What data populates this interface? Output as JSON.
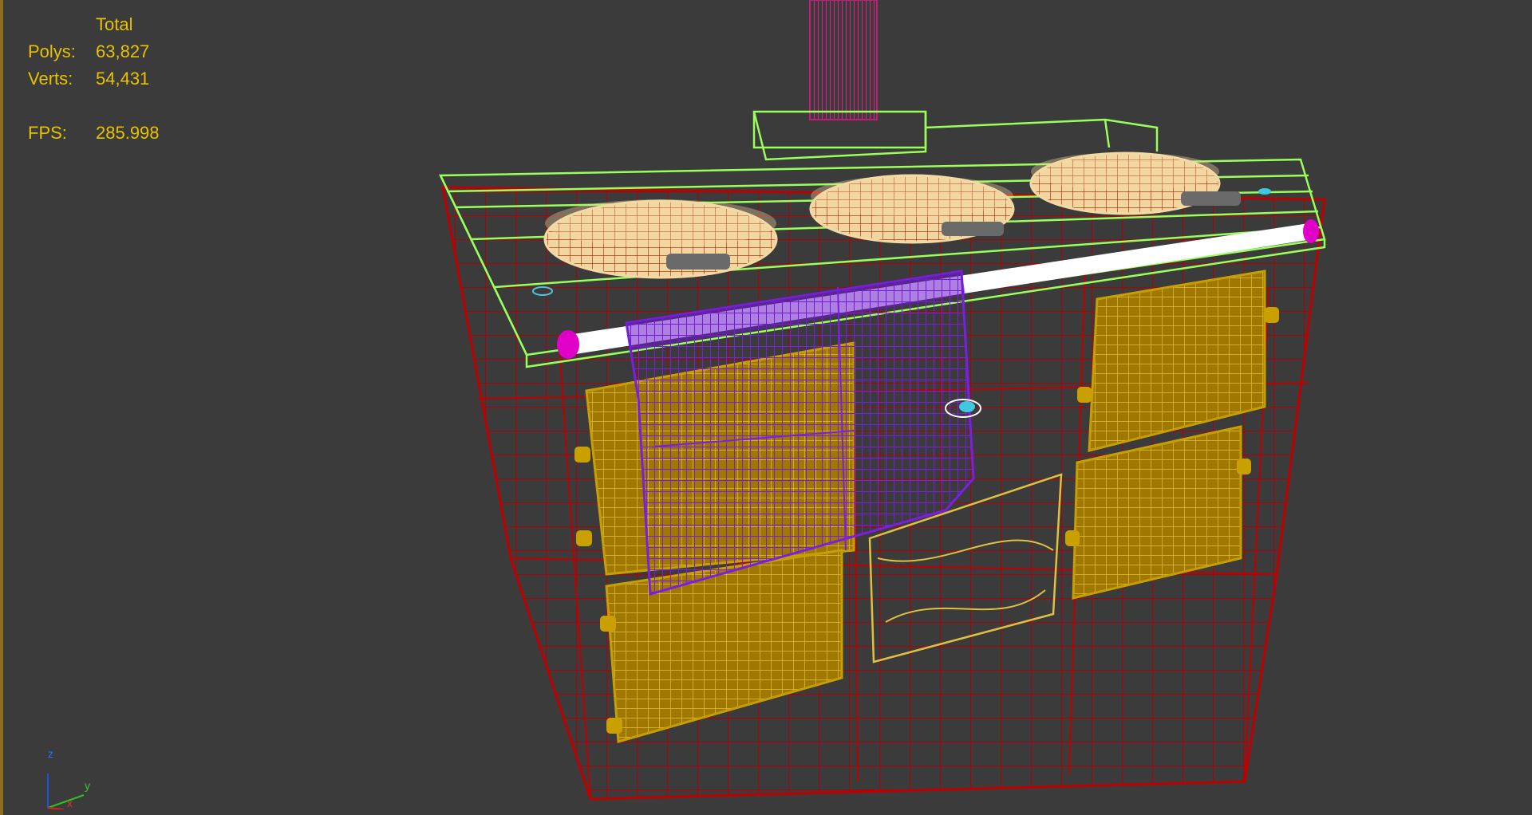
{
  "stats": {
    "header": "Total",
    "polys_label": "Polys:",
    "polys_value": "63,827",
    "verts_label": "Verts:",
    "verts_value": "54,431",
    "fps_label": "FPS:",
    "fps_value": "285.998"
  },
  "axis": {
    "z": "z",
    "y": "y",
    "x": "x"
  },
  "colors": {
    "background": "#3b3b3b",
    "stats_text": "#e8c200",
    "body_wire": "#b00000",
    "top_wire": "#9aff5a",
    "burner": "#f3d9a4",
    "door": "#a98000",
    "towel": "#7a1fe0",
    "rail": "#ffffff",
    "rail_cap": "#e000c8",
    "flue": "#e0208a"
  }
}
